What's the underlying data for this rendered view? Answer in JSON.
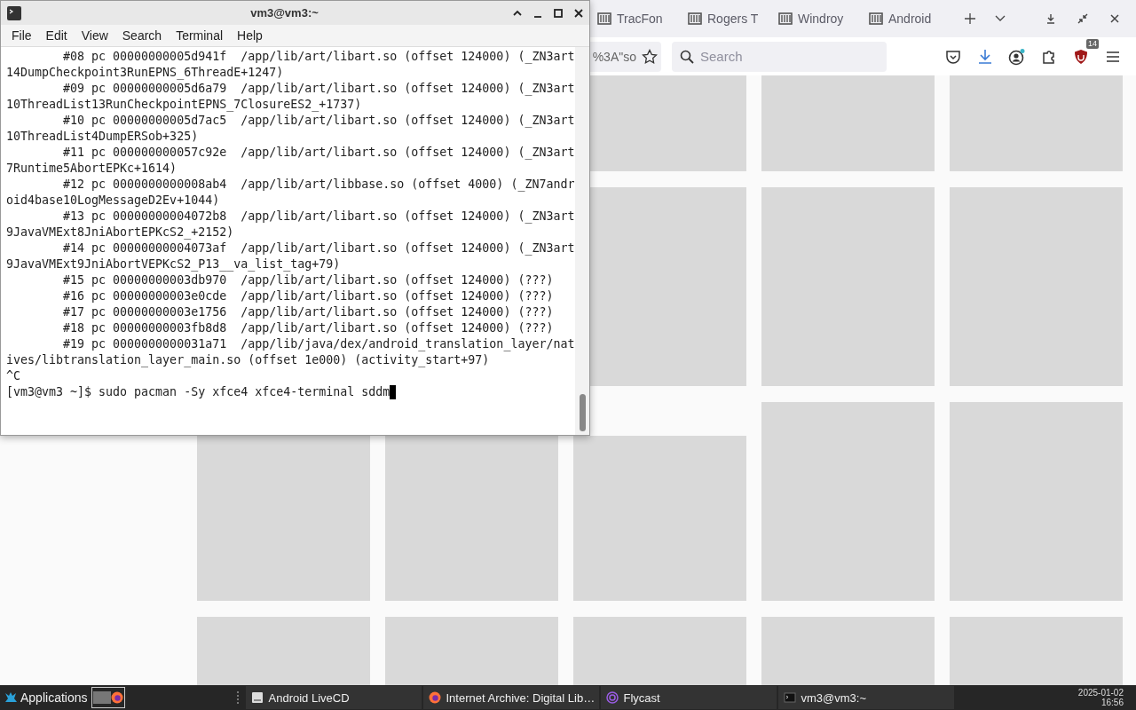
{
  "browser": {
    "tabs": [
      {
        "label": "TracFon"
      },
      {
        "label": "Rogers T"
      },
      {
        "label": "Windroy"
      },
      {
        "label": "Android"
      }
    ],
    "url": "%3A\"so",
    "search": {
      "placeholder": "Search"
    },
    "extension_badge": "14"
  },
  "terminal": {
    "title": "vm3@vm3:~",
    "menu": [
      "File",
      "Edit",
      "View",
      "Search",
      "Terminal",
      "Help"
    ],
    "lines": [
      "        #08 pc 00000000005d941f  /app/lib/art/libart.so (offset 124000) (_ZN3art",
      "14DumpCheckpoint3RunEPNS_6ThreadE+1247)",
      "        #09 pc 00000000005d6a79  /app/lib/art/libart.so (offset 124000) (_ZN3art",
      "10ThreadList13RunCheckpointEPNS_7ClosureES2_+1737)",
      "        #10 pc 00000000005d7ac5  /app/lib/art/libart.so (offset 124000) (_ZN3art",
      "10ThreadList4DumpERSob+325)",
      "        #11 pc 000000000057c92e  /app/lib/art/libart.so (offset 124000) (_ZN3art",
      "7Runtime5AbortEPKc+1614)",
      "        #12 pc 0000000000008ab4  /app/lib/art/libbase.so (offset 4000) (_ZN7andr",
      "oid4base10LogMessageD2Ev+1044)",
      "        #13 pc 00000000004072b8  /app/lib/art/libart.so (offset 124000) (_ZN3art",
      "9JavaVMExt8JniAbortEPKcS2_+2152)",
      "        #14 pc 00000000004073af  /app/lib/art/libart.so (offset 124000) (_ZN3art",
      "9JavaVMExt9JniAbortVEPKcS2_P13__va_list_tag+79)",
      "        #15 pc 00000000003db970  /app/lib/art/libart.so (offset 124000) (???)",
      "        #16 pc 00000000003e0cde  /app/lib/art/libart.so (offset 124000) (???)",
      "        #17 pc 00000000003e1756  /app/lib/art/libart.so (offset 124000) (???)",
      "        #18 pc 00000000003fb8d8  /app/lib/art/libart.so (offset 124000) (???)",
      "        #19 pc 0000000000031a71  /app/lib/java/dex/android_translation_layer/nat",
      "ives/libtranslation_layer_main.so (offset 1e000) (activity_start+97)",
      "^C"
    ],
    "prompt": "[vm3@vm3 ~]$ sudo pacman -Sy xfce4 xfce4-terminal sddm"
  },
  "taskbar": {
    "menu_label": "Applications",
    "tasks": [
      {
        "label": "Android LiveCD",
        "kind": "disk"
      },
      {
        "label": "Internet Archive: Digital Lib…",
        "kind": "firefox"
      },
      {
        "label": "Flycast",
        "kind": "flycast"
      },
      {
        "label": "vm3@vm3:~",
        "kind": "terminal"
      }
    ],
    "date": "2025-01-02",
    "time": "16:56"
  }
}
